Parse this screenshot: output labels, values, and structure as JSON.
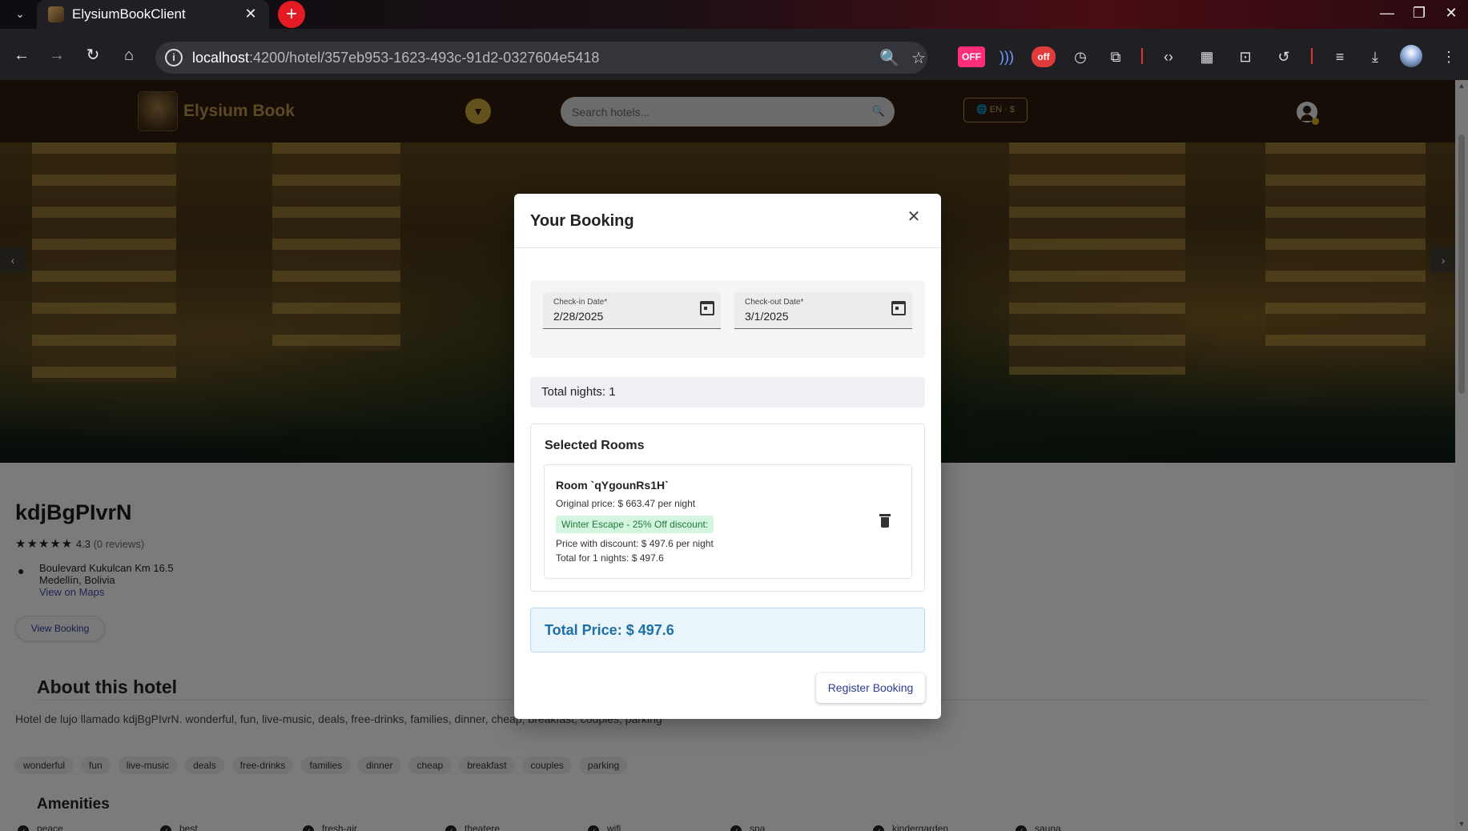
{
  "browser": {
    "tab_title": "ElysiumBookClient",
    "url_host": "localhost",
    "url_path": ":4200/hotel/357eb953-1623-493c-91d2-0327604e5418",
    "ext_off_1": "OFF",
    "ext_off_2": "off"
  },
  "header": {
    "logo_text": "Elysium Book",
    "search_placeholder": "Search hotels...",
    "lang_label": "EN · $"
  },
  "hotel": {
    "name": "kdjBgPIvrN",
    "rating": "4.3",
    "reviews": "(0 reviews)",
    "address_line1": "Boulevard Kukulcan Km 16.5",
    "address_line2": "Medellín, Bolivia",
    "maps_link": "View on Maps",
    "view_booking": "View Booking",
    "about_title": "About this hotel",
    "about_text": "Hotel de lujo llamado kdjBgPIvrN. wonderful, fun, live-music, deals, free-drinks, families, dinner, cheap, breakfast, couples, parking",
    "tags": [
      "wonderful",
      "fun",
      "live-music",
      "deals",
      "free-drinks",
      "families",
      "dinner",
      "cheap",
      "breakfast",
      "couples",
      "parking"
    ],
    "amenities_title": "Amenities",
    "amenities": [
      "peace",
      "best",
      "fresh-air",
      "theatere",
      "wifi",
      "spa",
      "kindergarden",
      "sauna"
    ]
  },
  "booking": {
    "title": "Your Booking",
    "checkin_label": "Check-in Date*",
    "checkin_value": "2/28/2025",
    "checkout_label": "Check-out Date*",
    "checkout_value": "3/1/2025",
    "nights_text": "Total nights: 1",
    "rooms_title": "Selected Rooms",
    "room": {
      "name": "Room `qYgounRs1H`",
      "original_price": "Original price: $ 663.47 per night",
      "discount": "Winter Escape - 25% Off discount:",
      "discount_price": "Price with discount: $ 497.6 per night",
      "total": "Total for 1 nights: $ 497.6"
    },
    "total_price": "Total Price: $ 497.6",
    "register_label": "Register Booking"
  },
  "icons": {
    "tab_dropdown": "chevron-down-icon",
    "close": "close-icon",
    "search": "search-icon",
    "filter": "filter-icon",
    "globe": "globe-icon",
    "calendar": "calendar-icon",
    "trash": "trash-icon",
    "location": "location-pin-icon",
    "star": "star-icon"
  },
  "colors": {
    "header_bg": "#2a1a0c",
    "brand_gold": "#b9924c",
    "total_blue": "#1d6fa5",
    "discount_green": "#1f7a3d",
    "button_text": "#2c3c94"
  }
}
